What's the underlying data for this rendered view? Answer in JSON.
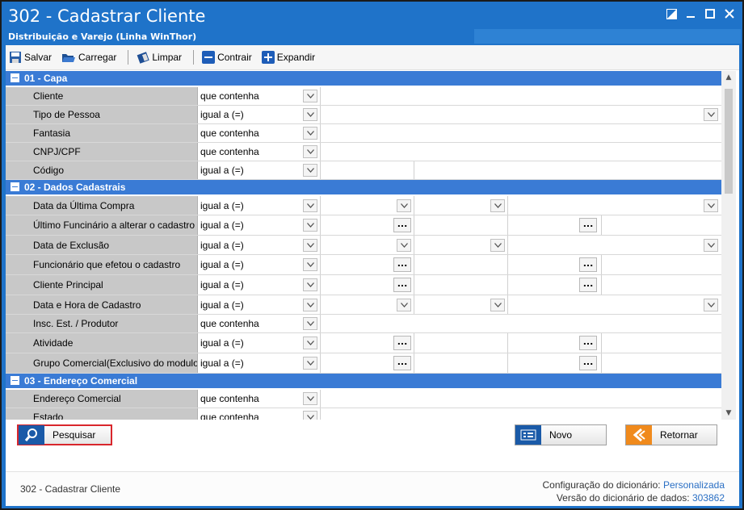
{
  "window": {
    "title": "302 - Cadastrar Cliente",
    "subtitle": "Distribuição e Varejo (Linha WinThor)"
  },
  "toolbar": {
    "salvar": "Salvar",
    "carregar": "Carregar",
    "limpar": "Limpar",
    "contrair": "Contrair",
    "expandir": "Expandir"
  },
  "sections": [
    {
      "title": "01 - Capa",
      "rows": [
        {
          "label": "Cliente",
          "op": "que contenha",
          "kind": "text1"
        },
        {
          "label": "Tipo de Pessoa",
          "op": "igual a (=)",
          "kind": "combo1"
        },
        {
          "label": "Fantasia",
          "op": "que contenha",
          "kind": "text1"
        },
        {
          "label": "CNPJ/CPF",
          "op": "que contenha",
          "kind": "text1"
        },
        {
          "label": "Código",
          "op": "igual a (=)",
          "kind": "text2"
        }
      ]
    },
    {
      "title": "02 - Dados Cadastrais",
      "rows": [
        {
          "label": "Data da Última Compra",
          "op": "igual a (=)",
          "kind": "date"
        },
        {
          "label": "Último Funcinário a alterar o cadastro",
          "op": "igual a (=)",
          "kind": "lookup"
        },
        {
          "label": "Data de Exclusão",
          "op": "igual a (=)",
          "kind": "date"
        },
        {
          "label": "Funcionário que efetou o cadastro",
          "op": "igual a (=)",
          "kind": "lookup"
        },
        {
          "label": "Cliente Principal",
          "op": "igual a (=)",
          "kind": "lookup"
        },
        {
          "label": "Data e Hora de Cadastro",
          "op": "igual a (=)",
          "kind": "date"
        },
        {
          "label": "Insc. Est. / Produtor",
          "op": "que contenha",
          "kind": "text1"
        },
        {
          "label": "Atividade",
          "op": "igual a (=)",
          "kind": "lookup"
        },
        {
          "label": "Grupo Comercial(Exclusivo do modulo",
          "op": "igual a (=)",
          "kind": "lookup"
        }
      ]
    },
    {
      "title": "03 - Endereço Comercial",
      "rows": [
        {
          "label": "Endereço Comercial",
          "op": "que contenha",
          "kind": "text1"
        },
        {
          "label": "Estado",
          "op": "que contenha",
          "kind": "text1"
        }
      ]
    }
  ],
  "buttons": {
    "pesquisar": "Pesquisar",
    "novo": "Novo",
    "retornar": "Retornar"
  },
  "status": {
    "screen": "302 - Cadastrar Cliente",
    "config_label": "Configuração do dicionário:",
    "config_value": "Personalizada",
    "version_label": "Versão do dicionário de dados:",
    "version_value": "303862"
  },
  "colors": {
    "title_bar": "#1f73c9",
    "section_header": "#3a7bd5",
    "highlight_border": "#d9262c",
    "retornar_accent": "#f08a1c"
  }
}
